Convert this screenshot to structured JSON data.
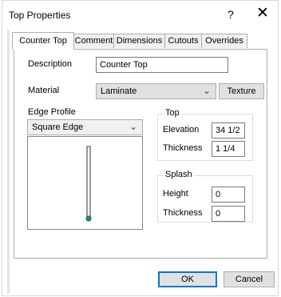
{
  "window": {
    "title": "Top Properties",
    "help_glyph": "?",
    "close_glyph": "✕"
  },
  "tabs": [
    {
      "label": "Counter Top",
      "active": true
    },
    {
      "label": "Comment",
      "active": false
    },
    {
      "label": "Dimensions",
      "active": false
    },
    {
      "label": "Cutouts",
      "active": false
    },
    {
      "label": "Overrides",
      "active": false
    }
  ],
  "form": {
    "description_label": "Description",
    "description_value": "Counter Top",
    "material_label": "Material",
    "material_value": "Laminate",
    "texture_button": "Texture",
    "edge_profile_label": "Edge Profile",
    "edge_profile_value": "Square Edge"
  },
  "top_group": {
    "title": "Top",
    "elevation_label": "Elevation",
    "elevation_value": "34 1/2",
    "thickness_label": "Thickness",
    "thickness_value": "1 1/4"
  },
  "splash_group": {
    "title": "Splash",
    "height_label": "Height",
    "height_value": "0",
    "thickness_label": "Thickness",
    "thickness_value": "0"
  },
  "buttons": {
    "ok": "OK",
    "cancel": "Cancel"
  },
  "colors": {
    "accent": "#0078d7",
    "profile_handle": "#1e8f7a"
  }
}
